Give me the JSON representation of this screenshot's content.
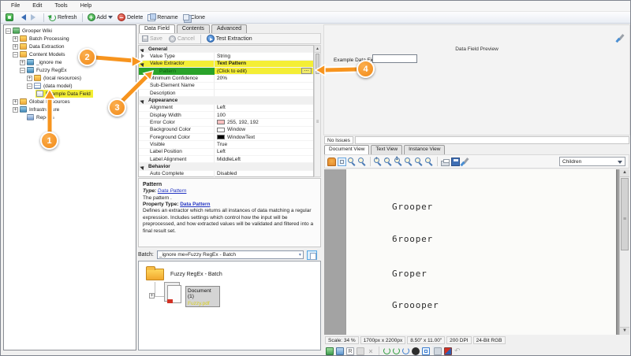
{
  "menu": {
    "items": [
      "File",
      "Edit",
      "Tools",
      "Help"
    ]
  },
  "toolbar": {
    "refresh": "Refresh",
    "add": "Add",
    "delete": "Delete",
    "rename": "Rename",
    "clone": "Clone"
  },
  "tree": {
    "items": [
      {
        "label": "Grooper Wiki"
      },
      {
        "label": "Batch Processing"
      },
      {
        "label": "Data Extraction"
      },
      {
        "label": "Content Models"
      },
      {
        "label": "_ignore me"
      },
      {
        "label": "Fuzzy RegEx"
      },
      {
        "label": "(local resources)"
      },
      {
        "label": "(data model)"
      },
      {
        "label": "Example Data Field"
      },
      {
        "label": "Global Resources"
      },
      {
        "label": "Infrastructure"
      },
      {
        "label": "Reports"
      }
    ]
  },
  "properties_panel": {
    "tabs": [
      "Data Field",
      "Contents",
      "Advanced"
    ],
    "commands": {
      "save": "Save",
      "cancel": "Cancel",
      "test": "Test Extraction"
    },
    "grid": {
      "ellipsis": "…",
      "rows": [
        {
          "name": "General",
          "value": ""
        },
        {
          "name": "Value Type",
          "value": "String"
        },
        {
          "name": "Value Extractor",
          "value": "Text Pattern"
        },
        {
          "name": "Pattern",
          "value": "(Click to edit)"
        },
        {
          "name": "Minimum Confidence",
          "value": "20%"
        },
        {
          "name": "Sub-Element Name",
          "value": ""
        },
        {
          "name": "Description",
          "value": ""
        },
        {
          "name": "Appearance",
          "value": ""
        },
        {
          "name": "Alignment",
          "value": "Left"
        },
        {
          "name": "Display Width",
          "value": "100"
        },
        {
          "name": "Error Color",
          "value": "255, 192, 192"
        },
        {
          "name": "Background Color",
          "value": "Window"
        },
        {
          "name": "Foreground Color",
          "value": "WindowText"
        },
        {
          "name": "Visible",
          "value": "True"
        },
        {
          "name": "Label Position",
          "value": "Left"
        },
        {
          "name": "Label Alignment",
          "value": "MiddleLeft"
        },
        {
          "name": "Behavior",
          "value": ""
        },
        {
          "name": "Auto Complete",
          "value": "Disabled"
        }
      ]
    },
    "description": {
      "title": "Pattern",
      "type_label": "Type:",
      "type_link": "Data Pattern",
      "line": "The pattern .",
      "property_type_label": "Property Type:",
      "property_type_link": "Data Pattern",
      "body": "Defines an extractor which returns all instances of data matching a regular expression. Includes settings which control how the input will be preprocessed, and how extracted values will be validated and filtered into a final result set."
    },
    "batch": {
      "label": "Batch:",
      "value": "_ignore me»Fuzzy RegEx - Batch",
      "folder": "Fuzzy RegEx - Batch",
      "document": "Document (1)",
      "file": "Fuzzy.pdf"
    }
  },
  "preview": {
    "title": "Data Field Preview",
    "field_label": "Example Data Field",
    "field_value": "",
    "issues": "No Issues",
    "tabs": [
      "Document View",
      "Text View",
      "Instance View"
    ],
    "children_dropdown": "Children",
    "doc_lines": [
      "Grooper",
      "6rooper",
      "Groper",
      "Groooper"
    ],
    "status": [
      "Scale: 34 %",
      "1700px x 2200px",
      "8.50\" x 11.00\"",
      "200 DPI",
      "24-Bit RGB"
    ]
  },
  "callouts": [
    {
      "n": "1"
    },
    {
      "n": "2"
    },
    {
      "n": "3"
    },
    {
      "n": "4"
    }
  ],
  "colors": {
    "highlight": "#f4ee35",
    "selected_green": "#2aa32a",
    "callout_orange": "#f7941e",
    "link_blue": "#2435c2"
  }
}
